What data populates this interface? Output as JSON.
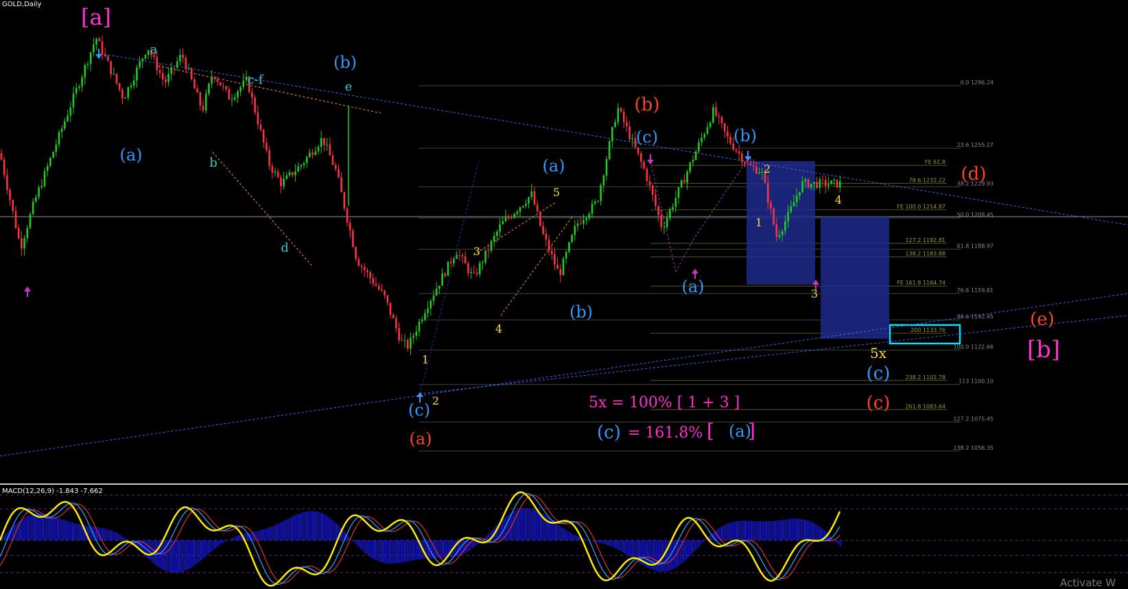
{
  "chart_title": "GOLD,Daily",
  "macd_title": "MACD(12,26,9) -1.843 -7.662",
  "watermark": "Activate W",
  "colors": {
    "bg": "#000000",
    "bull": "#22cc22",
    "bear": "#ff3344",
    "trend": "#4466ff",
    "orange": "#ff9922",
    "magenta": "#ff33cc",
    "blue": "#3399ff",
    "cyan": "#33cccc",
    "yellow": "#ffdd33",
    "red": "#ff4422",
    "zone": "#1e2a8c",
    "box": "#00e5ff",
    "macd_hist": "#1a1aff",
    "macd_main": "#ffee00"
  },
  "chart_data": {
    "type": "candlestick",
    "symbol": "GOLD",
    "timeframe": "Daily",
    "ylim": [
      1050,
      1340
    ],
    "price_path": [
      [
        0,
        1252
      ],
      [
        30,
        1190
      ],
      [
        50,
        1220
      ],
      [
        140,
        1328
      ],
      [
        180,
        1288
      ],
      [
        215,
        1322
      ],
      [
        240,
        1298
      ],
      [
        265,
        1317
      ],
      [
        295,
        1280
      ],
      [
        310,
        1305
      ],
      [
        335,
        1288
      ],
      [
        360,
        1300
      ],
      [
        392,
        1245
      ],
      [
        410,
        1232
      ],
      [
        440,
        1245
      ],
      [
        470,
        1262
      ],
      [
        490,
        1240
      ],
      [
        520,
        1182
      ],
      [
        560,
        1158
      ],
      [
        585,
        1128
      ],
      [
        595,
        1125
      ],
      [
        620,
        1150
      ],
      [
        665,
        1188
      ],
      [
        690,
        1170
      ],
      [
        730,
        1205
      ],
      [
        775,
        1225
      ],
      [
        790,
        1200
      ],
      [
        815,
        1172
      ],
      [
        840,
        1205
      ],
      [
        870,
        1220
      ],
      [
        900,
        1282
      ],
      [
        940,
        1240
      ],
      [
        965,
        1203
      ],
      [
        990,
        1228
      ],
      [
        1040,
        1280
      ],
      [
        1060,
        1262
      ],
      [
        1090,
        1244
      ],
      [
        1110,
        1240
      ],
      [
        1132,
        1197
      ],
      [
        1150,
        1212
      ],
      [
        1168,
        1232
      ]
    ],
    "levels": [
      {
        "tick": "0.0 1296.24",
        "price": 1296.24
      },
      {
        "tick": "23.6 1255.27",
        "price": 1255.27
      },
      {
        "tick": "38.2 1229.93",
        "price": 1229.93
      },
      {
        "tick": "50.0 1209.45",
        "price": 1209.45
      },
      {
        "tick": "61.8 1188.97",
        "price": 1188.97
      },
      {
        "tick": "76.6 1159.81",
        "price": 1159.81
      },
      {
        "tick": "88.6 1142.45",
        "price": 1142.45
      },
      {
        "tick": "100.0 1122.66",
        "price": 1122.66
      },
      {
        "tick": "113 1100.10",
        "price": 1100.1
      },
      {
        "tick": "127.2 1075.45",
        "price": 1075.45
      },
      {
        "tick": "138.2 1056.35",
        "price": 1056.35
      }
    ],
    "fe_levels": [
      {
        "tick": "FE 61.8",
        "price": 1244
      },
      {
        "tick": "78.6 1232.22",
        "price": 1232.22
      },
      {
        "tick": "FE 100.0 1214.87",
        "price": 1214.87
      },
      {
        "tick": "127.2 1192.81",
        "price": 1192.81
      },
      {
        "tick": "138.2 1183.88",
        "price": 1183.88
      },
      {
        "tick": "FE 161.8 1164.74",
        "price": 1164.74
      },
      {
        "tick": "200 1133.76",
        "price": 1133.76
      },
      {
        "tick": "238.2 1102.78",
        "price": 1102.78
      },
      {
        "tick": "261.8 1083.64",
        "price": 1083.64
      }
    ],
    "wave_labels": [
      {
        "text": "[a]",
        "color": "magenta",
        "x": 140,
        "y": 36,
        "size": 32
      },
      {
        "text": "a",
        "color": "cyan",
        "x": 224,
        "y": 78,
        "size": 18
      },
      {
        "text": "(a)",
        "color": "blue",
        "x": 191,
        "y": 234,
        "size": 24
      },
      {
        "text": "b",
        "color": "cyan",
        "x": 311,
        "y": 243,
        "size": 18
      },
      {
        "text": "c-f",
        "color": "cyan",
        "x": 372,
        "y": 122,
        "size": 18
      },
      {
        "text": "d",
        "color": "cyan",
        "x": 415,
        "y": 367,
        "size": 18
      },
      {
        "text": "(b)",
        "color": "blue",
        "x": 503,
        "y": 99,
        "size": 24
      },
      {
        "text": "e",
        "color": "cyan",
        "x": 508,
        "y": 132,
        "size": 18
      },
      {
        "text": "(c)",
        "color": "blue",
        "x": 611,
        "y": 606,
        "size": 24
      },
      {
        "text": "(a)",
        "color": "red",
        "x": 613,
        "y": 648,
        "size": 24
      },
      {
        "text": "1",
        "color": "yellow",
        "x": 620,
        "y": 530,
        "size": 16
      },
      {
        "text": "2",
        "color": "yellow",
        "x": 635,
        "y": 590,
        "size": 16
      },
      {
        "text": "3",
        "color": "yellow",
        "x": 695,
        "y": 372,
        "size": 16
      },
      {
        "text": "4",
        "color": "yellow",
        "x": 727,
        "y": 485,
        "size": 16
      },
      {
        "text": "5",
        "color": "yellow",
        "x": 811,
        "y": 286,
        "size": 16
      },
      {
        "text": "(a)",
        "color": "blue",
        "x": 807,
        "y": 250,
        "size": 24
      },
      {
        "text": "(b)",
        "color": "blue",
        "x": 847,
        "y": 463,
        "size": 24
      },
      {
        "text": "(b)",
        "color": "red",
        "x": 943,
        "y": 161,
        "size": 26
      },
      {
        "text": "(c)",
        "color": "blue",
        "x": 943,
        "y": 208,
        "size": 24
      },
      {
        "text": "(b)",
        "color": "blue",
        "x": 1086,
        "y": 206,
        "size": 24
      },
      {
        "text": "2",
        "color": "yellow",
        "x": 1118,
        "y": 252,
        "size": 16
      },
      {
        "text": "1",
        "color": "yellow",
        "x": 1106,
        "y": 330,
        "size": 16
      },
      {
        "text": "(a)",
        "color": "blue",
        "x": 1010,
        "y": 426,
        "size": 24
      },
      {
        "text": "3",
        "color": "yellow",
        "x": 1187,
        "y": 434,
        "size": 16
      },
      {
        "text": "4",
        "color": "yellow",
        "x": 1222,
        "y": 297,
        "size": 16
      },
      {
        "text": "(d)",
        "color": "red",
        "x": 1419,
        "y": 262,
        "size": 26
      },
      {
        "text": "(e)",
        "color": "red",
        "x": 1519,
        "y": 474,
        "size": 26
      },
      {
        "text": "[b]",
        "color": "magenta",
        "x": 1521,
        "y": 521,
        "size": 34
      },
      {
        "text": "5x",
        "color": "yellow",
        "x": 1280,
        "y": 522,
        "size": 20
      },
      {
        "text": "(c)",
        "color": "blue",
        "x": 1280,
        "y": 553,
        "size": 26
      },
      {
        "text": "(c)",
        "color": "red",
        "x": 1280,
        "y": 596,
        "size": 26
      }
    ],
    "annotations": [
      {
        "text": "5x = 100% [ 1 + 3 ]",
        "color": "magenta",
        "x": 858,
        "y": 594,
        "size": 22
      },
      {
        "text": "(c)",
        "color": "blue",
        "x": 870,
        "y": 639,
        "size": 26
      },
      {
        "text": "= 161.8%",
        "color": "magenta",
        "x": 915,
        "y": 638,
        "size": 22
      },
      {
        "text": "[",
        "color": "magenta",
        "x": 1030,
        "y": 638,
        "size": 28
      },
      {
        "text": "(a)",
        "color": "blue",
        "x": 1062,
        "y": 637,
        "size": 24
      },
      {
        "text": "]",
        "color": "magenta",
        "x": 1090,
        "y": 638,
        "size": 28
      }
    ],
    "macd": {
      "title": "MACD(12,26,9) -1.843 -7.662",
      "main": -1.843,
      "signal": -7.662
    }
  }
}
